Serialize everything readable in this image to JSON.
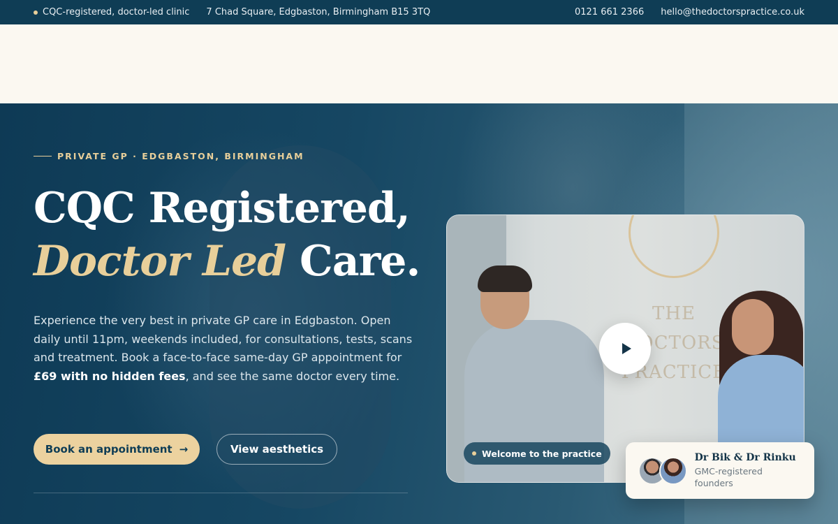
{
  "topbar": {
    "registration": "CQC-registered, doctor-led clinic",
    "address": "7 Chad Square, Edgbaston, Birmingham B15 3TQ",
    "phone": "0121 661 2366",
    "email": "hello@thedoctorspractice.co.uk"
  },
  "hero": {
    "eyebrow": "PRIVATE GP · EDGBASTON, BIRMINGHAM",
    "headline_line1": "CQC Registered,",
    "headline_accent": "Doctor Led",
    "headline_end": " Care.",
    "lead_part1": "Experience the very best in private GP care in Edgbaston. Open daily until 11pm, weekends included, for consultations, tests, scans and treatment. Book a face-to-face same-day GP appointment for ",
    "lead_bold": "£69 with no hidden fees",
    "lead_part2": ", and see the same doctor every time.",
    "primary_button": "Book an appointment",
    "primary_arrow": "→",
    "secondary_button": "View aesthetics"
  },
  "video": {
    "logo_text": "THE DOCTORS PRACTICE",
    "welcome_label": "Welcome to the practice",
    "play_icon": "play-icon"
  },
  "founders": {
    "name": "Dr Bik & Dr Rinku",
    "role": "GMC-registered founders"
  },
  "colors": {
    "navy": "#0f3d55",
    "gold": "#e8cf9a",
    "cream": "#fbf8f1"
  }
}
